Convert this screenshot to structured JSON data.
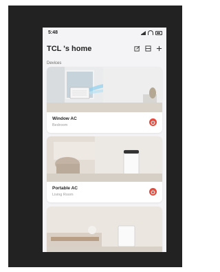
{
  "status_bar": {
    "time": "5:48"
  },
  "header": {
    "title": "TCL 's home"
  },
  "section_label": "Devices",
  "devices": [
    {
      "name": "Window AC",
      "room": "Bedroom"
    },
    {
      "name": "Portable AC",
      "room": "Living Room"
    }
  ],
  "colors": {
    "accent": "#e84a3b",
    "background": "#f4f4f6",
    "frame": "#222222"
  },
  "icons": [
    "signal-icon",
    "wifi-icon",
    "battery-icon",
    "edit-icon",
    "list-icon",
    "plus-icon",
    "power-icon"
  ]
}
